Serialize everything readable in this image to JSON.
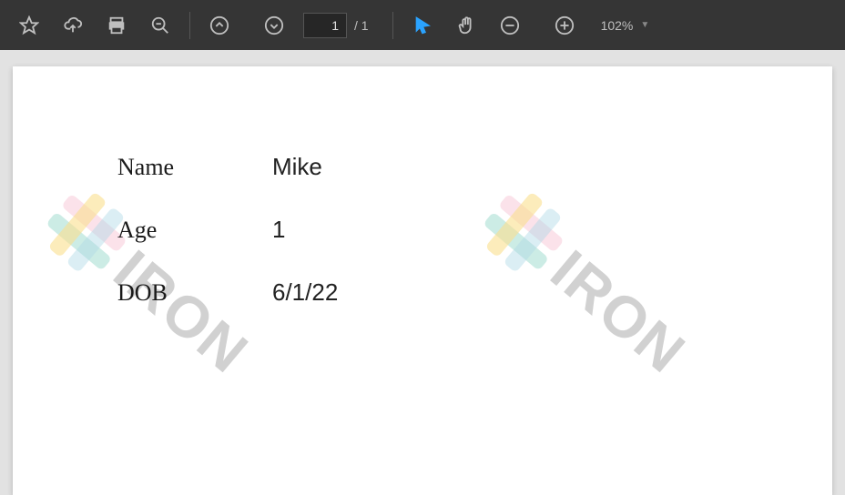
{
  "toolbar": {
    "current_page": "1",
    "page_sep": "/",
    "total_pages": "1",
    "zoom": "102%"
  },
  "doc": {
    "watermark_text": "IRON",
    "fields": [
      {
        "label": "Name",
        "value": "Mike"
      },
      {
        "label": "Age",
        "value": "1"
      },
      {
        "label": "DOB",
        "value": "6/1/22"
      }
    ]
  }
}
